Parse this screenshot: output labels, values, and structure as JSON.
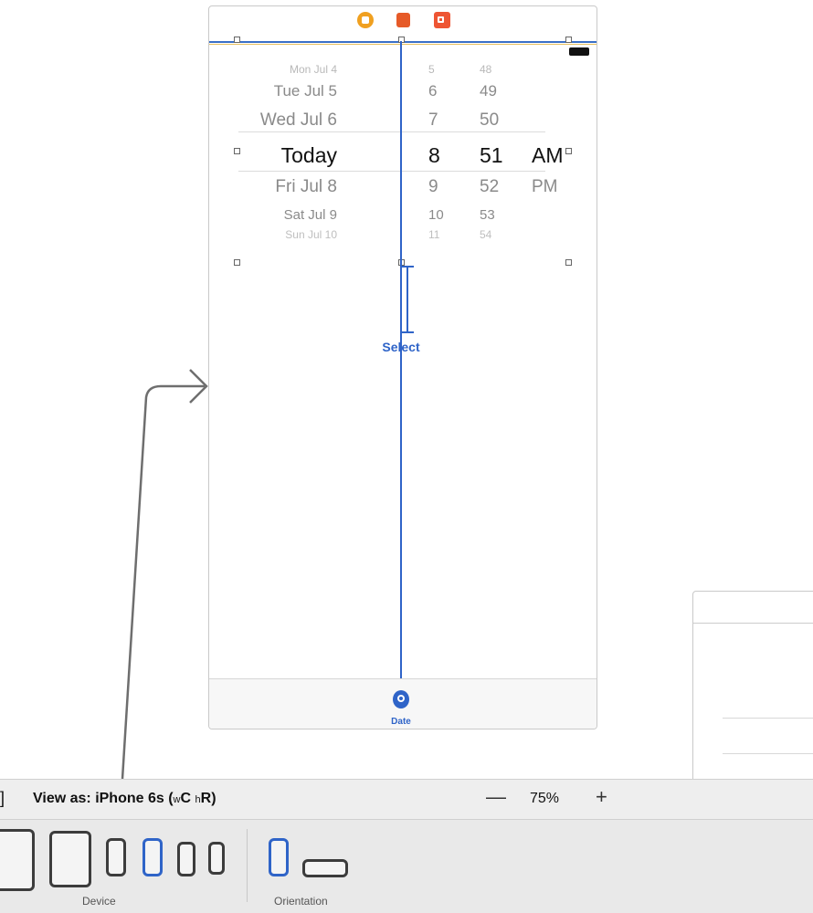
{
  "picker": {
    "rows": [
      {
        "date": "Mon Jul 4",
        "hour": "5",
        "minute": "48",
        "ampm": ""
      },
      {
        "date": "Tue Jul 5",
        "hour": "6",
        "minute": "49",
        "ampm": ""
      },
      {
        "date": "Wed Jul 6",
        "hour": "7",
        "minute": "50",
        "ampm": ""
      },
      {
        "date": "Today",
        "hour": "8",
        "minute": "51",
        "ampm": "AM"
      },
      {
        "date": "Fri Jul 8",
        "hour": "9",
        "minute": "52",
        "ampm": "PM"
      },
      {
        "date": "Sat Jul 9",
        "hour": "10",
        "minute": "53",
        "ampm": ""
      },
      {
        "date": "Sun Jul 10",
        "hour": "11",
        "minute": "54",
        "ampm": ""
      }
    ]
  },
  "scene": {
    "select_label": "Select",
    "tab_label": "Date"
  },
  "toolbar": {
    "left_glyph": "]",
    "view_as_label": "View as: iPhone 6s (",
    "size_w": "w",
    "size_c": "C",
    "size_h": "h",
    "size_r": "R",
    "view_as_close": ")",
    "zoom_out": "—",
    "zoom_level": "75%",
    "zoom_in": "+"
  },
  "panel": {
    "device_label": "Device",
    "orientation_label": "Orientation"
  },
  "colors": {
    "selection_blue": "#2f64c8",
    "accent_orange": "#f0a020",
    "first_responder_red": "#e65a28"
  },
  "icons": [
    "view-controller-icon",
    "first-responder-icon",
    "exit-icon",
    "battery-icon",
    "date-tab-icon",
    "ipad-pro-icon",
    "ipad-icon",
    "iphone-icon",
    "portrait-icon",
    "landscape-icon"
  ]
}
